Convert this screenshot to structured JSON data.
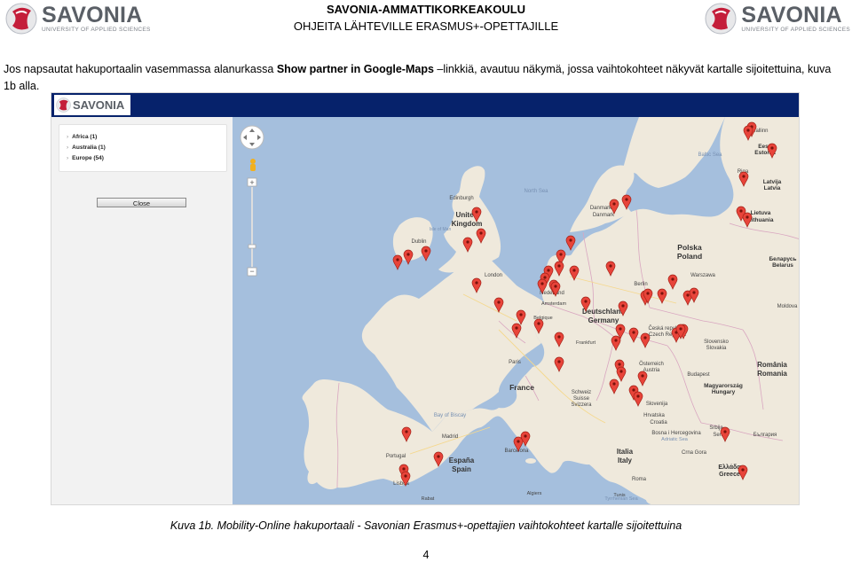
{
  "header": {
    "logo_text": "SAVONIA",
    "logo_subtitle": "UNIVERSITY OF APPLIED SCIENCES",
    "line1": "SAVONIA-AMMATTIKORKEAKOULU",
    "line2": "OHJEITA LÄHTEVILLE ERASMUS+-OPETTAJILLE"
  },
  "paragraph": {
    "part1": "Jos napsautat hakuportaalin vasemmassa alanurkassa ",
    "bold": "Show partner in Google-Maps",
    "part2": " –linkkiä, avautuu näkymä, jossa vaihtokohteet näkyvät kartalle sijoitettuina, kuva 1b alla."
  },
  "screenshot": {
    "logo_text": "SAVONIA",
    "tree": [
      {
        "label": "Africa (1)"
      },
      {
        "label": "Australia (1)"
      },
      {
        "label": "Europe (54)"
      }
    ],
    "close_label": "Close",
    "map_labels": [
      {
        "text": "North Sea"
      },
      {
        "text": "Edinburgh"
      },
      {
        "text": "United"
      },
      {
        "text": "Kingdom"
      },
      {
        "text": "Dublin"
      },
      {
        "text": "Isle of Man"
      },
      {
        "text": "London"
      },
      {
        "text": "Danmark"
      },
      {
        "text": "Danmark"
      },
      {
        "text": "Nederland"
      },
      {
        "text": "Amsterdam"
      },
      {
        "text": "Berlin"
      },
      {
        "text": "Deutschland"
      },
      {
        "text": "Germany"
      },
      {
        "text": "Belgique"
      },
      {
        "text": "Frankfurt"
      },
      {
        "text": "Paris"
      },
      {
        "text": "France"
      },
      {
        "text": "Schweiz"
      },
      {
        "text": "Suisse"
      },
      {
        "text": "Svizzera"
      },
      {
        "text": "Bay of Biscay"
      },
      {
        "text": "Italia"
      },
      {
        "text": "Italy"
      },
      {
        "text": "Roma"
      },
      {
        "text": "España"
      },
      {
        "text": "Spain"
      },
      {
        "text": "Madrid"
      },
      {
        "text": "Barcelona"
      },
      {
        "text": "Portugal"
      },
      {
        "text": "Lisboa"
      },
      {
        "text": "Polska"
      },
      {
        "text": "Poland"
      },
      {
        "text": "Warszawa"
      },
      {
        "text": "Česká republika"
      },
      {
        "text": "Czech Republic"
      },
      {
        "text": "Österreich"
      },
      {
        "text": "Austria"
      },
      {
        "text": "Slovensko"
      },
      {
        "text": "Slovakia"
      },
      {
        "text": "Budapest"
      },
      {
        "text": "Magyarország"
      },
      {
        "text": "Hungary"
      },
      {
        "text": "Slovenija"
      },
      {
        "text": "Hrvatska"
      },
      {
        "text": "Croatia"
      },
      {
        "text": "Bosna i Hercegovina"
      },
      {
        "text": "Srbija"
      },
      {
        "text": "Serbia"
      },
      {
        "text": "Crna Gora"
      },
      {
        "text": "România"
      },
      {
        "text": "Romania"
      },
      {
        "text": "Беларусь"
      },
      {
        "text": "Belarus"
      },
      {
        "text": "Lietuva"
      },
      {
        "text": "Lithuania"
      },
      {
        "text": "Latvija"
      },
      {
        "text": "Latvia"
      },
      {
        "text": "Riga"
      },
      {
        "text": "Eesti"
      },
      {
        "text": "Estonia"
      },
      {
        "text": "Tallinn"
      },
      {
        "text": "Baltic Sea"
      },
      {
        "text": "Tyrrhenian Sea"
      },
      {
        "text": "Adriatic Sea"
      },
      {
        "text": "България"
      },
      {
        "text": "Ελλάδα"
      },
      {
        "text": "Greece"
      },
      {
        "text": "Moldova"
      },
      {
        "text": "Tunis"
      },
      {
        "text": "Algiers"
      },
      {
        "text": "Rabat"
      }
    ]
  },
  "caption": "Kuva 1b. Mobility-Online hakuportaali - Savonian Erasmus+-opettajien vaihtokohteet kartalle sijoitettuina",
  "page_number": "4"
}
